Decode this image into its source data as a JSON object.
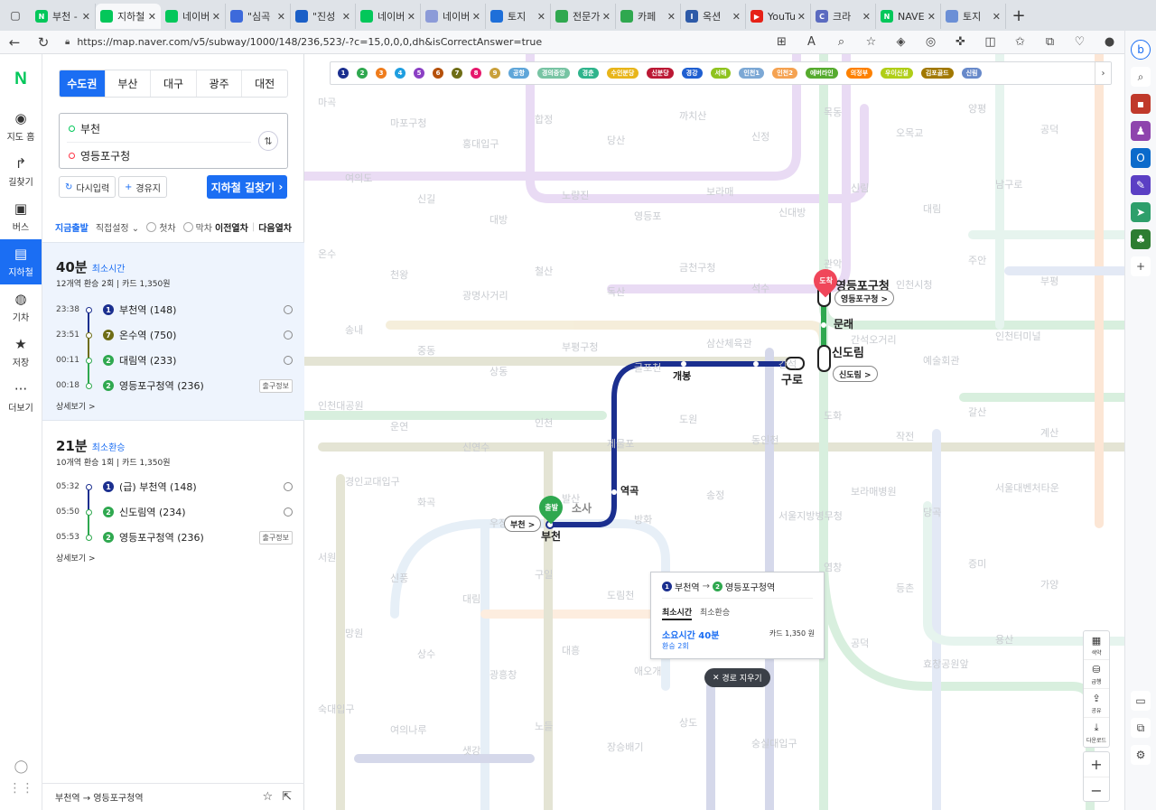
{
  "browser": {
    "tabs": [
      {
        "label": "부천 -",
        "fav_color": "#03c75a",
        "fav_glyph": "N"
      },
      {
        "label": "지하철",
        "fav_color": "#03c75a",
        "fav_glyph": "",
        "active": true
      },
      {
        "label": "네이버",
        "fav_color": "#03c75a",
        "fav_glyph": ""
      },
      {
        "label": "\"심곡",
        "fav_color": "#3d6adb",
        "fav_glyph": ""
      },
      {
        "label": "\"진성",
        "fav_color": "#1b5fc7",
        "fav_glyph": ""
      },
      {
        "label": "네이버",
        "fav_color": "#03c75a",
        "fav_glyph": ""
      },
      {
        "label": "네이버",
        "fav_color": "#8c9bd8",
        "fav_glyph": ""
      },
      {
        "label": "토지",
        "fav_color": "#1e6fd9",
        "fav_glyph": ""
      },
      {
        "label": "전문가",
        "fav_color": "#2fa84f",
        "fav_glyph": ""
      },
      {
        "label": "카페",
        "fav_color": "#2fa84f",
        "fav_glyph": ""
      },
      {
        "label": "옥션",
        "fav_color": "#2d5aa8",
        "fav_glyph": "I"
      },
      {
        "label": "YouTu",
        "fav_color": "#e62117",
        "fav_glyph": "▶"
      },
      {
        "label": "크라",
        "fav_color": "#5b6bc0",
        "fav_glyph": "C"
      },
      {
        "label": "NAVE",
        "fav_color": "#03c75a",
        "fav_glyph": "N"
      },
      {
        "label": "토지",
        "fav_color": "#6b8fd6",
        "fav_glyph": ""
      }
    ],
    "new_tab": "+",
    "url": "https://map.naver.com/v5/subway/1000/148/236,523/-?c=15,0,0,0,dh&isCorrectAnswer=true"
  },
  "rail": {
    "logo": "N",
    "items": [
      {
        "label": "지도 홈",
        "icon": "map-pin-icon",
        "glyph": "◉"
      },
      {
        "label": "길찾기",
        "icon": "directions-icon",
        "glyph": "↱"
      },
      {
        "label": "버스",
        "icon": "bus-icon",
        "glyph": "▣"
      },
      {
        "label": "지하철",
        "icon": "subway-icon",
        "glyph": "▤",
        "active": true
      },
      {
        "label": "기차",
        "icon": "train-icon",
        "glyph": "◍"
      },
      {
        "label": "저장",
        "icon": "star-icon",
        "glyph": "★"
      },
      {
        "label": "더보기",
        "icon": "more-icon",
        "glyph": "···"
      }
    ]
  },
  "panel": {
    "regions": [
      "수도권",
      "부산",
      "대구",
      "광주",
      "대전"
    ],
    "active_region": "수도권",
    "start_station": "부천",
    "end_station": "영등포구청",
    "reset_label": "다시입력",
    "waypoint_label": "경유지",
    "search_label": "지하철 길찾기",
    "options": {
      "depart_now": "지금출발",
      "direct_setting": "직접설정",
      "first_train": "첫차",
      "last_train": "막차",
      "prev_train": "이전열차",
      "next_train": "다음열차"
    },
    "results": [
      {
        "duration": "40분",
        "tag": "최소시간",
        "summary": "12개역  환승 2회  |  카드 1,350원",
        "steps": [
          {
            "time": "23:38",
            "line": "1",
            "line_color": "#1b2f8f",
            "name": "부천역 (148)",
            "action": "clock"
          },
          {
            "time": "23:51",
            "line": "7",
            "line_color": "#6e6d16",
            "name": "온수역 (750)",
            "action": "clock"
          },
          {
            "time": "00:11",
            "line": "2",
            "line_color": "#2fa84f",
            "name": "대림역 (233)",
            "action": "clock"
          },
          {
            "time": "00:18",
            "line": "2",
            "line_color": "#2fa84f",
            "name": "영등포구청역 (236)",
            "action": "exit"
          }
        ],
        "more": "상세보기 >"
      },
      {
        "duration": "21분",
        "tag": "최소환승",
        "summary": "10개역  환승 1회  |  카드 1,350원",
        "steps": [
          {
            "time": "05:32",
            "line": "1",
            "line_color": "#1b2f8f",
            "name": "(급) 부천역 (148)",
            "action": "clock"
          },
          {
            "time": "05:50",
            "line": "2",
            "line_color": "#2fa84f",
            "name": "신도림역 (234)",
            "action": "clock"
          },
          {
            "time": "05:53",
            "line": "2",
            "line_color": "#2fa84f",
            "name": "영등포구청역 (236)",
            "action": "exit"
          }
        ],
        "more": "상세보기 >"
      }
    ],
    "exit_info_label": "출구정보",
    "footer": "부천역 → 영등포구청역"
  },
  "map": {
    "legend": [
      {
        "label": "1",
        "color": "#1b2f8f",
        "n": true
      },
      {
        "label": "2",
        "color": "#2fa84f",
        "n": true
      },
      {
        "label": "3",
        "color": "#ef7c1c",
        "n": true
      },
      {
        "label": "4",
        "color": "#1e9ee0",
        "n": true
      },
      {
        "label": "5",
        "color": "#8b3fc4",
        "n": true
      },
      {
        "label": "6",
        "color": "#b5500b",
        "n": true
      },
      {
        "label": "7",
        "color": "#6e6d16",
        "n": true
      },
      {
        "label": "8",
        "color": "#e6186c",
        "n": true
      },
      {
        "label": "9",
        "color": "#c9a03a",
        "n": true
      },
      {
        "label": "공항",
        "color": "#5fa6d9"
      },
      {
        "label": "경의중앙",
        "color": "#77c4a3"
      },
      {
        "label": "경춘",
        "color": "#2fb48c"
      },
      {
        "label": "수인분당",
        "color": "#e8b51a"
      },
      {
        "label": "신분당",
        "color": "#bb1834"
      },
      {
        "label": "경강",
        "color": "#1f5fd1"
      },
      {
        "label": "서해",
        "color": "#8fc31f"
      },
      {
        "label": "인천1",
        "color": "#7ca8d5"
      },
      {
        "label": "인천2",
        "color": "#f5a251"
      },
      {
        "label": "에버라인",
        "color": "#56ab2f"
      },
      {
        "label": "의정부",
        "color": "#fd8100"
      },
      {
        "label": "우이신설",
        "color": "#b0ce18"
      },
      {
        "label": "김포골드",
        "color": "#a17800"
      },
      {
        "label": "신림",
        "color": "#6789ca"
      }
    ],
    "start_pin": "출발",
    "end_pin": "도착",
    "start_pill": "부천 >",
    "end_pill": "영등포구청 >",
    "transfer_pill": "신도림 >",
    "stations_highlight": {
      "start": "부천",
      "end": "영등포구청",
      "sindorim": "신도림",
      "guro": "구로",
      "mullae": "문래",
      "gaebong": "개봉",
      "yeokgok": "역곡",
      "sosa": "소사"
    },
    "bg_labels": [
      "마곡",
      "마포구청",
      "홍대입구",
      "합정",
      "당산",
      "까치산",
      "신정",
      "목동",
      "오목교",
      "양평",
      "공덕",
      "여의도",
      "신길",
      "대방",
      "노량진",
      "영등포",
      "보라매",
      "신대방",
      "신림",
      "대림",
      "남구로",
      "가산디지털단지",
      "온수",
      "천왕",
      "광명사거리",
      "철산",
      "독산",
      "금천구청",
      "석수",
      "관악",
      "인천시청",
      "주안",
      "부평",
      "송내",
      "중동",
      "상동",
      "부평구청",
      "굴포천",
      "삼산체육관",
      "간석",
      "간석오거리",
      "예술회관",
      "인천터미널",
      "문학경기장",
      "인천대공원",
      "운연",
      "신연수",
      "인천",
      "제물포",
      "도원",
      "동인천",
      "도화",
      "작전",
      "갈산",
      "계산",
      "경인교대입구",
      "화곡",
      "우장산",
      "발산",
      "방화",
      "송정",
      "서울지방병무청",
      "보라매병원",
      "당곡",
      "서울대벤처타운",
      "봉천",
      "서원",
      "신풍",
      "대림",
      "구일",
      "도림천",
      "양천구청",
      "신정네거리",
      "염창",
      "등촌",
      "증미",
      "가양",
      "망원",
      "상수",
      "광흥창",
      "대흥",
      "애오개",
      "신촌",
      "서강대",
      "공덕",
      "효창공원앞",
      "용산",
      "남영",
      "숙대입구",
      "여의나루",
      "샛강",
      "노들",
      "장승배기",
      "상도",
      "숭실대입구"
    ],
    "popup": {
      "from": "부천역",
      "to": "영등포구청역",
      "from_line": "1",
      "to_line": "2",
      "tab_active": "최소시간",
      "tab_other": "최소환승",
      "duration": "소요시간 40분",
      "transfer": "환승 2회",
      "fare": "카드 1,350 원"
    },
    "clear_label": "경로 지우기",
    "tools": [
      {
        "label": "색약",
        "icon": "palette-icon",
        "glyph": "▦"
      },
      {
        "label": "급행",
        "icon": "express-icon",
        "glyph": "⛁"
      },
      {
        "label": "공유",
        "icon": "share-icon",
        "glyph": "⇪"
      },
      {
        "label": "다운로드",
        "icon": "download-icon",
        "glyph": "⤓"
      }
    ],
    "zoom_in": "+",
    "zoom_out": "−"
  }
}
